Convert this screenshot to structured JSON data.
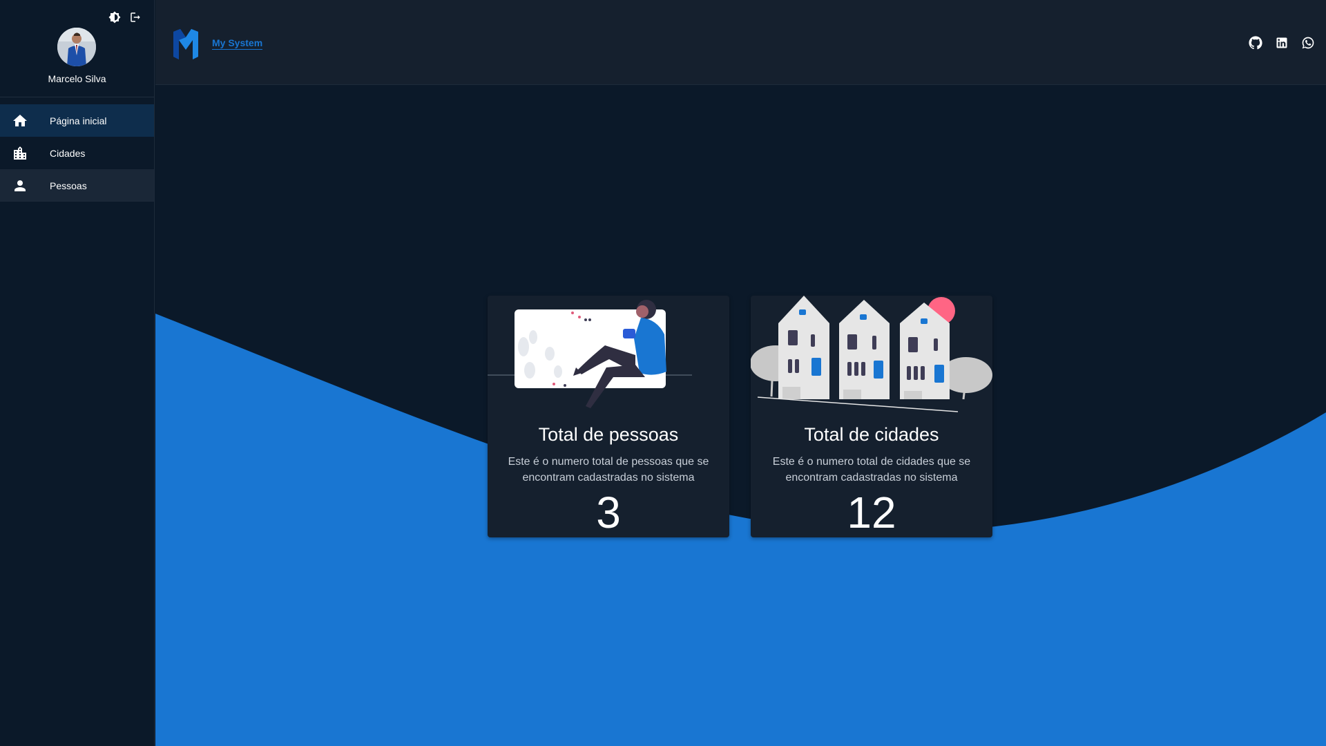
{
  "user": {
    "name": "Marcelo Silva"
  },
  "sidebar": {
    "actions": [
      {
        "icon": "brightness-icon"
      },
      {
        "icon": "logout-icon"
      }
    ],
    "items": [
      {
        "label": "Página inicial",
        "icon": "home-icon",
        "state": "active"
      },
      {
        "label": "Cidades",
        "icon": "city-icon",
        "state": "normal"
      },
      {
        "label": "Pessoas",
        "icon": "person-icon",
        "state": "hover"
      }
    ]
  },
  "header": {
    "brand": "My System",
    "social": [
      "github-icon",
      "linkedin-icon",
      "whatsapp-icon"
    ]
  },
  "cards": {
    "people": {
      "title": "Total de pessoas",
      "description": "Este é o numero total de pessoas que se encontram cadastradas no sistema",
      "value": "3"
    },
    "cities": {
      "title": "Total de cidades",
      "description": "Este é o numero total de cidades que se encontram cadastradas no sistema",
      "value": "12"
    }
  },
  "colors": {
    "background": "#0b1929",
    "surface": "#15202e",
    "accent": "#1976d2",
    "active_nav": "#0e2d4c"
  }
}
